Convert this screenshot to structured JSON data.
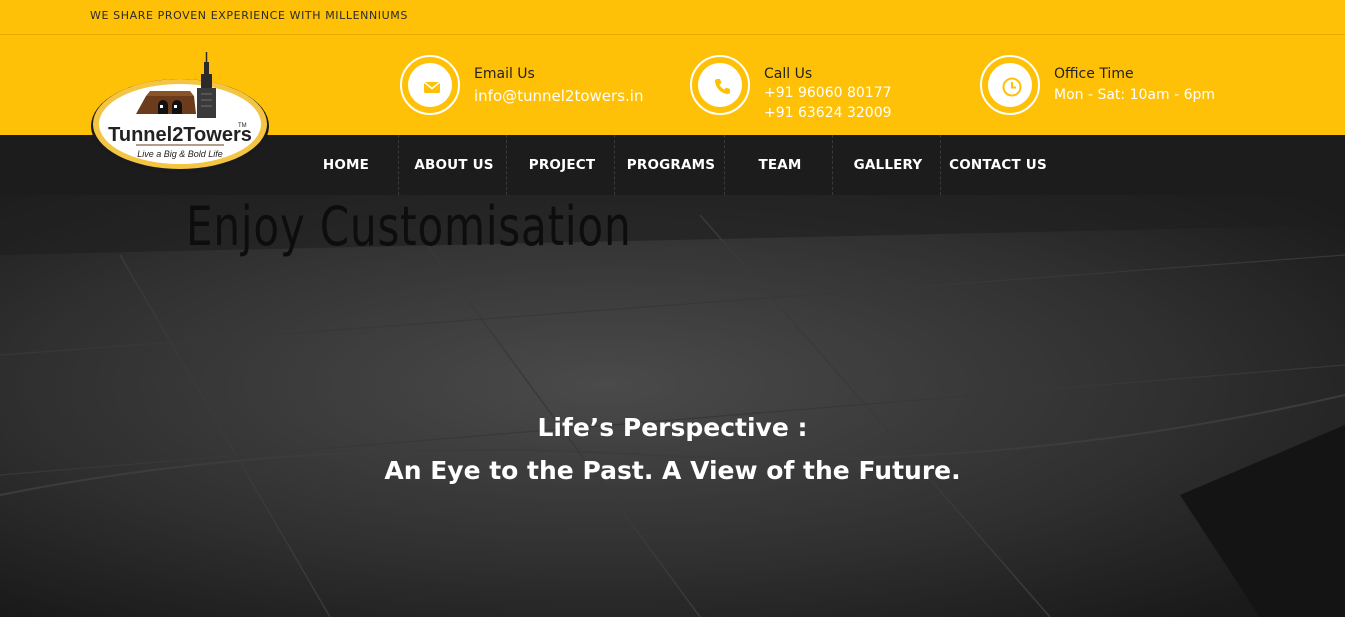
{
  "top_bar": {
    "tagline": "WE SHARE PROVEN EXPERIENCE WITH MILLENNIUMS"
  },
  "brand": {
    "name": "Tunnel2Towers",
    "slogan": "Live a Big & Bold Life",
    "tm": "TM"
  },
  "contact": {
    "email": {
      "title": "Email Us",
      "value": "info@tunnel2towers.in",
      "icon": "envelope-icon"
    },
    "phone": {
      "title": "Call Us",
      "line1": "+91 96060 80177",
      "line2": "+91 63624 32009",
      "icon": "phone-icon"
    },
    "hours": {
      "title": "Office Time",
      "value": "Mon - Sat: 10am - 6pm",
      "icon": "clock-icon"
    }
  },
  "nav": {
    "items": [
      {
        "label": "HOME"
      },
      {
        "label": "ABOUT US"
      },
      {
        "label": "PROJECT"
      },
      {
        "label": "PROGRAMS"
      },
      {
        "label": "TEAM"
      },
      {
        "label": "GALLERY"
      },
      {
        "label": "CONTACT US"
      }
    ]
  },
  "hero": {
    "title": "Enjoy Customisation",
    "line1": "Life’s Perspective :",
    "line2": "An Eye to the Past. A View of the Future."
  },
  "colors": {
    "accent": "#ffc107",
    "nav_bg": "#1c1c1c",
    "text_dark": "#222222",
    "logo_brown": "#6b3b1c"
  }
}
